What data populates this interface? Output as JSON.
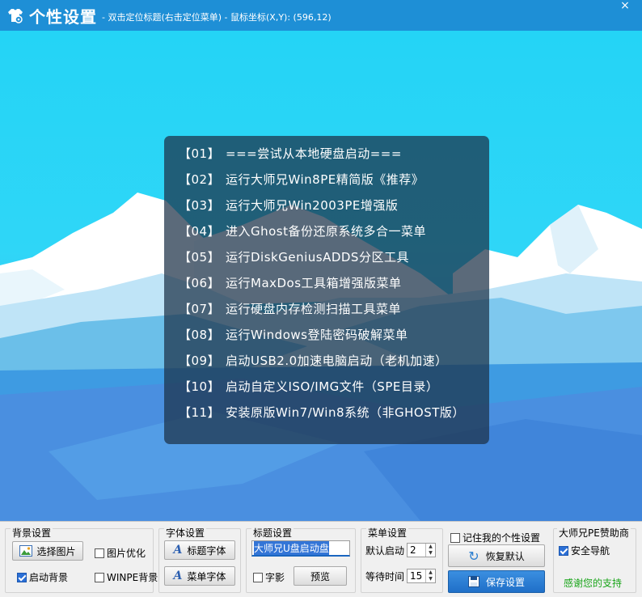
{
  "window": {
    "title": "个性设置",
    "subtitle": "- 双击定位标题(右击定位菜单) - 鼠标坐标(X,Y): (596,12)",
    "close_label": "×"
  },
  "menu": [
    {
      "num": "【01】",
      "label": "===尝试从本地硬盘启动==="
    },
    {
      "num": "【02】",
      "label": "运行大师兄Win8PE精简版《推荐》"
    },
    {
      "num": "【03】",
      "label": "运行大师兄Win2003PE增强版"
    },
    {
      "num": "【04】",
      "label": "进入Ghost备份还原系统多合一菜单"
    },
    {
      "num": "【05】",
      "label": "运行DiskGeniusADDS分区工具"
    },
    {
      "num": "【06】",
      "label": "运行MaxDos工具箱增强版菜单"
    },
    {
      "num": "【07】",
      "label": "运行硬盘内存检测扫描工具菜单"
    },
    {
      "num": "【08】",
      "label": "运行Windows登陆密码破解菜单"
    },
    {
      "num": "【09】",
      "label": "启动USB2.0加速电脑启动（老机加速）"
    },
    {
      "num": "【10】",
      "label": "启动自定义ISO/IMG文件（SPE目录）"
    },
    {
      "num": "【11】",
      "label": "安装原版Win7/Win8系统（非GHOST版）"
    }
  ],
  "background_group": {
    "title": "背景设置",
    "choose_image": "选择图片",
    "optimize_image": {
      "label": "图片优化",
      "checked": false
    },
    "boot_background": {
      "label": "启动背景",
      "checked": true
    },
    "winpe_background": {
      "label": "WINPE背景",
      "checked": false
    }
  },
  "font_group": {
    "title": "字体设置",
    "title_font": "标题字体",
    "menu_font": "菜单字体"
  },
  "title_group": {
    "title": "标题设置",
    "title_value": "大师兄U盘启动盘",
    "shadow": {
      "label": "字影",
      "checked": false
    },
    "preview": "预览"
  },
  "menu_group": {
    "title": "菜单设置",
    "default_boot_label": "默认启动",
    "default_boot_value": "2",
    "wait_time_label": "等待时间",
    "wait_time_value": "15"
  },
  "save_group": {
    "remember": {
      "label": "记住我的个性设置",
      "checked": false
    },
    "restore_default": "恢复默认",
    "save_settings": "保存设置"
  },
  "sponsor_group": {
    "title": "大师兄PE赞助商",
    "safe_nav": {
      "label": "安全导航",
      "checked": true
    },
    "thanks": "感谢您的支持"
  },
  "colors": {
    "titlebar": "#1e8fd6",
    "sky": "#2fd6f7",
    "thanks_text": "#1aa51a",
    "save_button": "#2a7ed6"
  }
}
